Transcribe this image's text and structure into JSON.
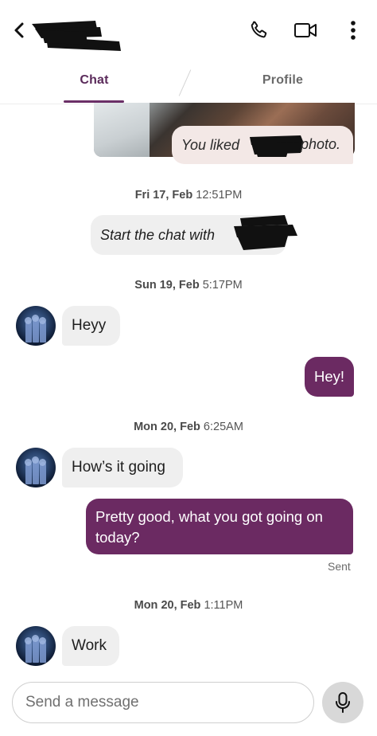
{
  "header": {
    "back_icon": "chevron-left-icon",
    "call_icon": "phone-icon",
    "video_icon": "video-camera-icon",
    "menu_icon": "more-vertical-icon"
  },
  "tabs": [
    {
      "label": "Chat",
      "active": true
    },
    {
      "label": "Profile",
      "active": false
    }
  ],
  "colors": {
    "accent": "#6b2a62",
    "incoming_bubble": "#efefef",
    "liked_bubble": "#f3e8e6"
  },
  "conversation": {
    "liked_photo": {
      "prefix": "You liked",
      "suffix": "photo."
    },
    "stamp1": {
      "day": "Fri 17, Feb",
      "time": "12:51PM"
    },
    "system_message": "Start the chat with",
    "stamp2": {
      "day": "Sun 19, Feb",
      "time": "5:17PM"
    },
    "msg1": "Heyy",
    "msg2": "Hey!",
    "stamp3": {
      "day": "Mon 20, Feb",
      "time": "6:25AM"
    },
    "msg3": "How’s it going",
    "msg4": "Pretty good, what you got going on today?",
    "sent_status": "Sent",
    "stamp4": {
      "day": "Mon 20, Feb",
      "time": "1:11PM"
    },
    "msg5": "Work"
  },
  "composer": {
    "placeholder": "Send a message",
    "mic_icon": "microphone-icon"
  }
}
